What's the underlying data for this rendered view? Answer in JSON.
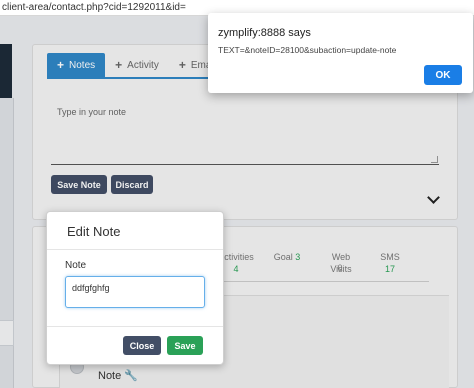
{
  "browser": {
    "url": "client-area/contact.php?cid=1292011&id="
  },
  "notes_panel": {
    "tabs": [
      {
        "icon": "+",
        "label": "Notes",
        "active": true
      },
      {
        "icon": "+",
        "label": "Activity",
        "active": false
      },
      {
        "icon": "+",
        "label": "Email",
        "active": false
      }
    ],
    "note_placeholder": "Type in your note",
    "save_note_label": "Save Note",
    "discard_label": "Discard"
  },
  "stats": [
    {
      "label": "Activities",
      "value": "4"
    },
    {
      "label": "Goal",
      "value": "3"
    },
    {
      "label": "Web Visits",
      "value": "0"
    },
    {
      "label": "SMS",
      "value": "17"
    }
  ],
  "timeline": {
    "note_label": "Note"
  },
  "edit_modal": {
    "title": "Edit Note",
    "field_label": "Note",
    "field_value": "ddfgfghfg",
    "close_label": "Close",
    "save_label": "Save"
  },
  "alert_dialog": {
    "title": "zymplify:8888 says",
    "message": "TEXT=&noteID=28100&subaction=update-note",
    "ok_label": "OK"
  },
  "colors": {
    "primary": "#2f86c6",
    "dark_button": "#424e66",
    "success": "#2aa157",
    "ok_button": "#1a7ee6"
  }
}
